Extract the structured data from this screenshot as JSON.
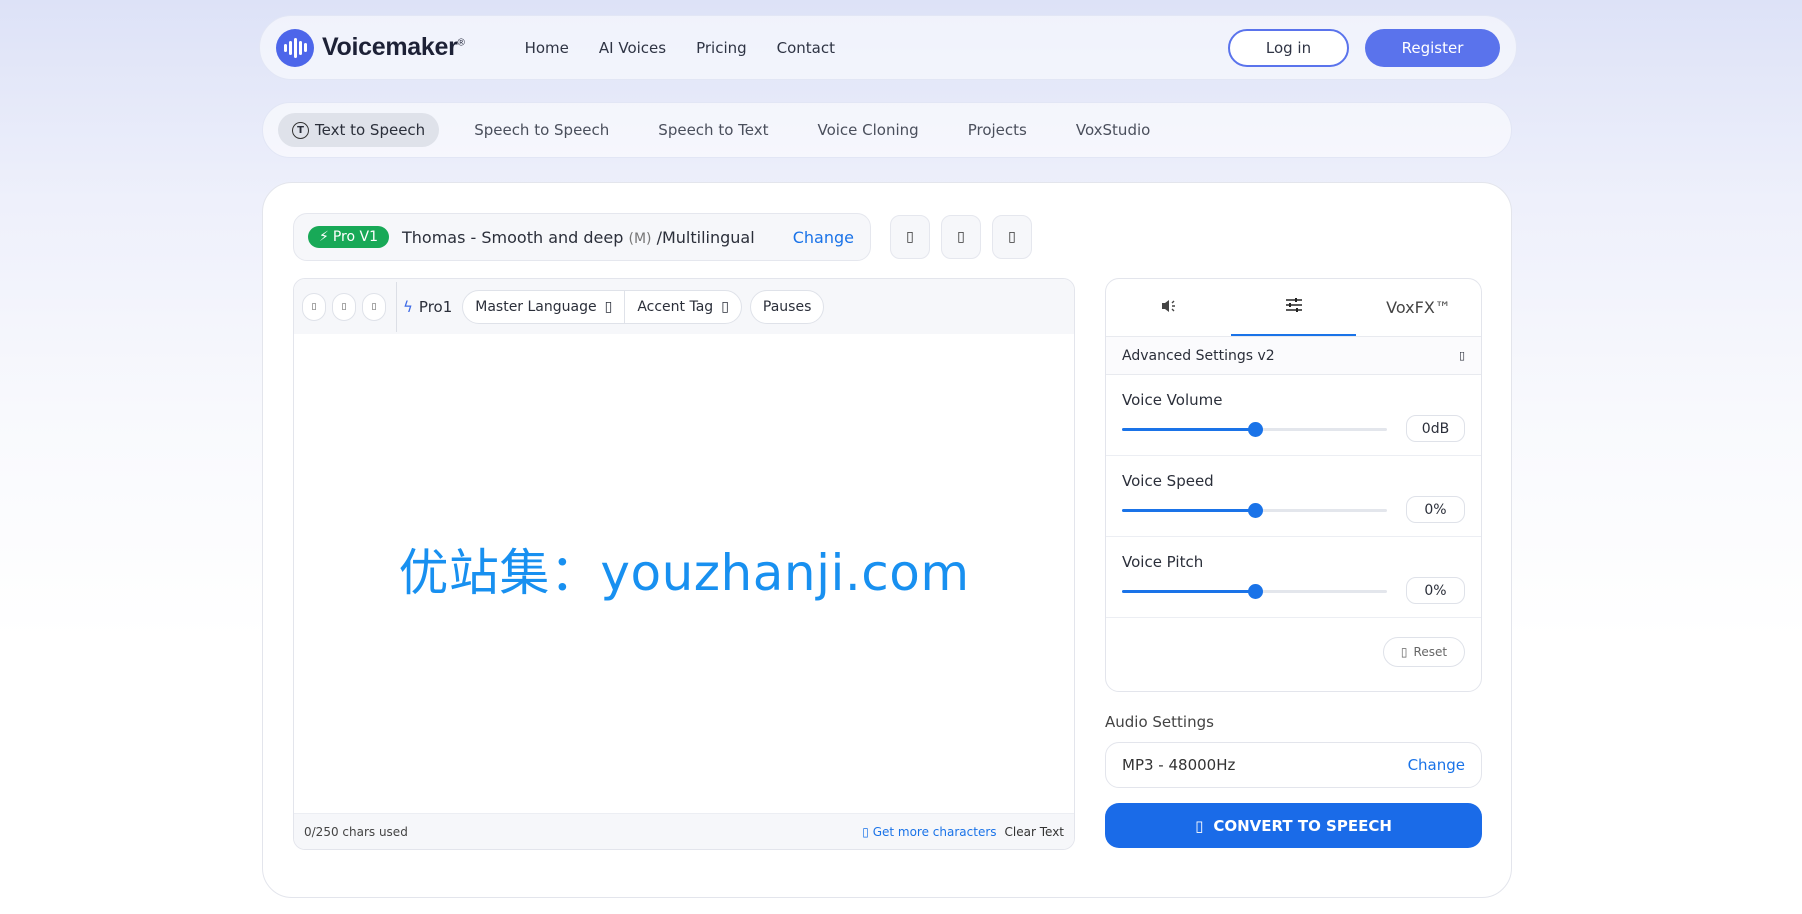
{
  "brand": {
    "name": "Voicemaker",
    "mark": "®"
  },
  "main_nav": [
    "Home",
    "AI Voices",
    "Pricing",
    "Contact"
  ],
  "auth": {
    "login": "Log in",
    "register": "Register"
  },
  "subnav": [
    {
      "label": "Text to Speech",
      "icon": "T",
      "active": true
    },
    {
      "label": "Speech to Speech",
      "active": false
    },
    {
      "label": "Speech to Text",
      "active": false
    },
    {
      "label": "Voice Cloning",
      "active": false
    },
    {
      "label": "Projects",
      "active": false
    },
    {
      "label": "VoxStudio",
      "active": false
    }
  ],
  "voice": {
    "badge": "Pro V1",
    "name": "Thomas - Smooth and deep",
    "gender": "(M)",
    "lang": "/Multilingual",
    "change": "Change"
  },
  "editor": {
    "engine": "Pro1",
    "controls": [
      {
        "label": "Master Language",
        "has_caret": true
      },
      {
        "label": "Accent Tag",
        "has_caret": true
      }
    ],
    "pauses": "Pauses",
    "watermark": "优站集：youzhanji.com",
    "chars_used": "0/250 chars used",
    "get_more": "Get more characters",
    "clear": "Clear Text"
  },
  "panel": {
    "tab_fx": "VoxFX™",
    "advanced_title": "Advanced Settings v2",
    "sliders": [
      {
        "label": "Voice Volume",
        "value": "0dB",
        "level": 0.5
      },
      {
        "label": "Voice Speed",
        "value": "0%",
        "level": 0.5
      },
      {
        "label": "Voice Pitch",
        "value": "0%",
        "level": 0.5
      }
    ],
    "reset": "Reset"
  },
  "audio": {
    "label": "Audio Settings",
    "value": "MP3 - 48000Hz",
    "change": "Change"
  },
  "convert": "CONVERT TO SPEECH",
  "colors": {
    "accent": "#1a73e8",
    "brand": "#4d66ea",
    "badge_green": "#18a957"
  }
}
